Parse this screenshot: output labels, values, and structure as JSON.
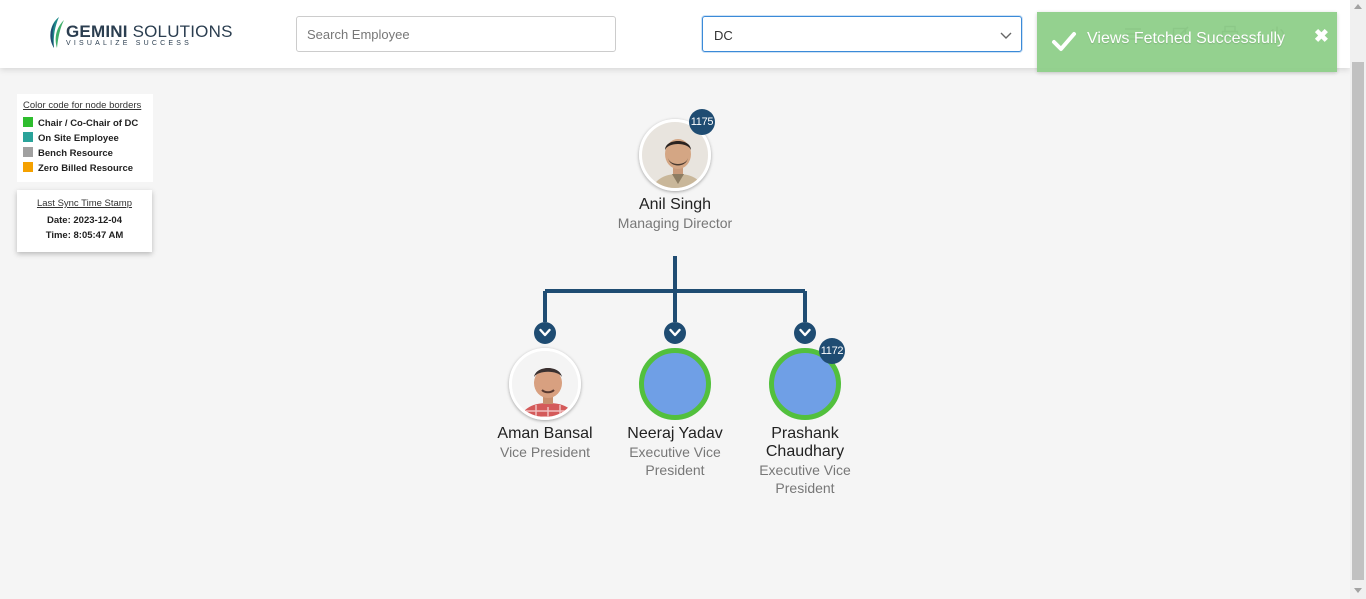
{
  "header": {
    "logo_brand_bold": "GEMINI",
    "logo_brand_rest": " SOLUTIONS",
    "logo_tagline": "VISUALIZE SUCCESS",
    "search_placeholder": "Search Employee",
    "view_select_value": "DC",
    "icons": [
      "menu-icon",
      "edit-icon",
      "print-icon",
      "power-icon"
    ]
  },
  "toast": {
    "message": "Views Fetched Successfully",
    "close_label": "✖",
    "color": "#8fcf8a"
  },
  "legend": {
    "title": "Color code for node borders",
    "items": [
      {
        "label": "Chair / Co-Chair of DC",
        "color": "#2ebd2e"
      },
      {
        "label": "On Site Employee",
        "color": "#2aa39a"
      },
      {
        "label": "Bench Resource",
        "color": "#a0a0a0"
      },
      {
        "label": "Zero Billed Resource",
        "color": "#f5a100"
      }
    ]
  },
  "sync": {
    "title": "Last Sync Time Stamp",
    "date": "Date: 2023-12-04",
    "time": "Time: 8:05:47 AM"
  },
  "org": {
    "root": {
      "name": "Anil Singh",
      "role": "Managing Director",
      "badge": "1175"
    },
    "children": [
      {
        "name": "Aman Bansal",
        "role": "Vice President",
        "badge": ""
      },
      {
        "name": "Neeraj Yadav",
        "role": "Executive Vice President",
        "badge": ""
      },
      {
        "name": "Prashank Chaudhary",
        "role": "Executive Vice President",
        "badge": "1172"
      }
    ],
    "connector_color": "#1f4c72",
    "chair_border_color": "#52c03d"
  }
}
